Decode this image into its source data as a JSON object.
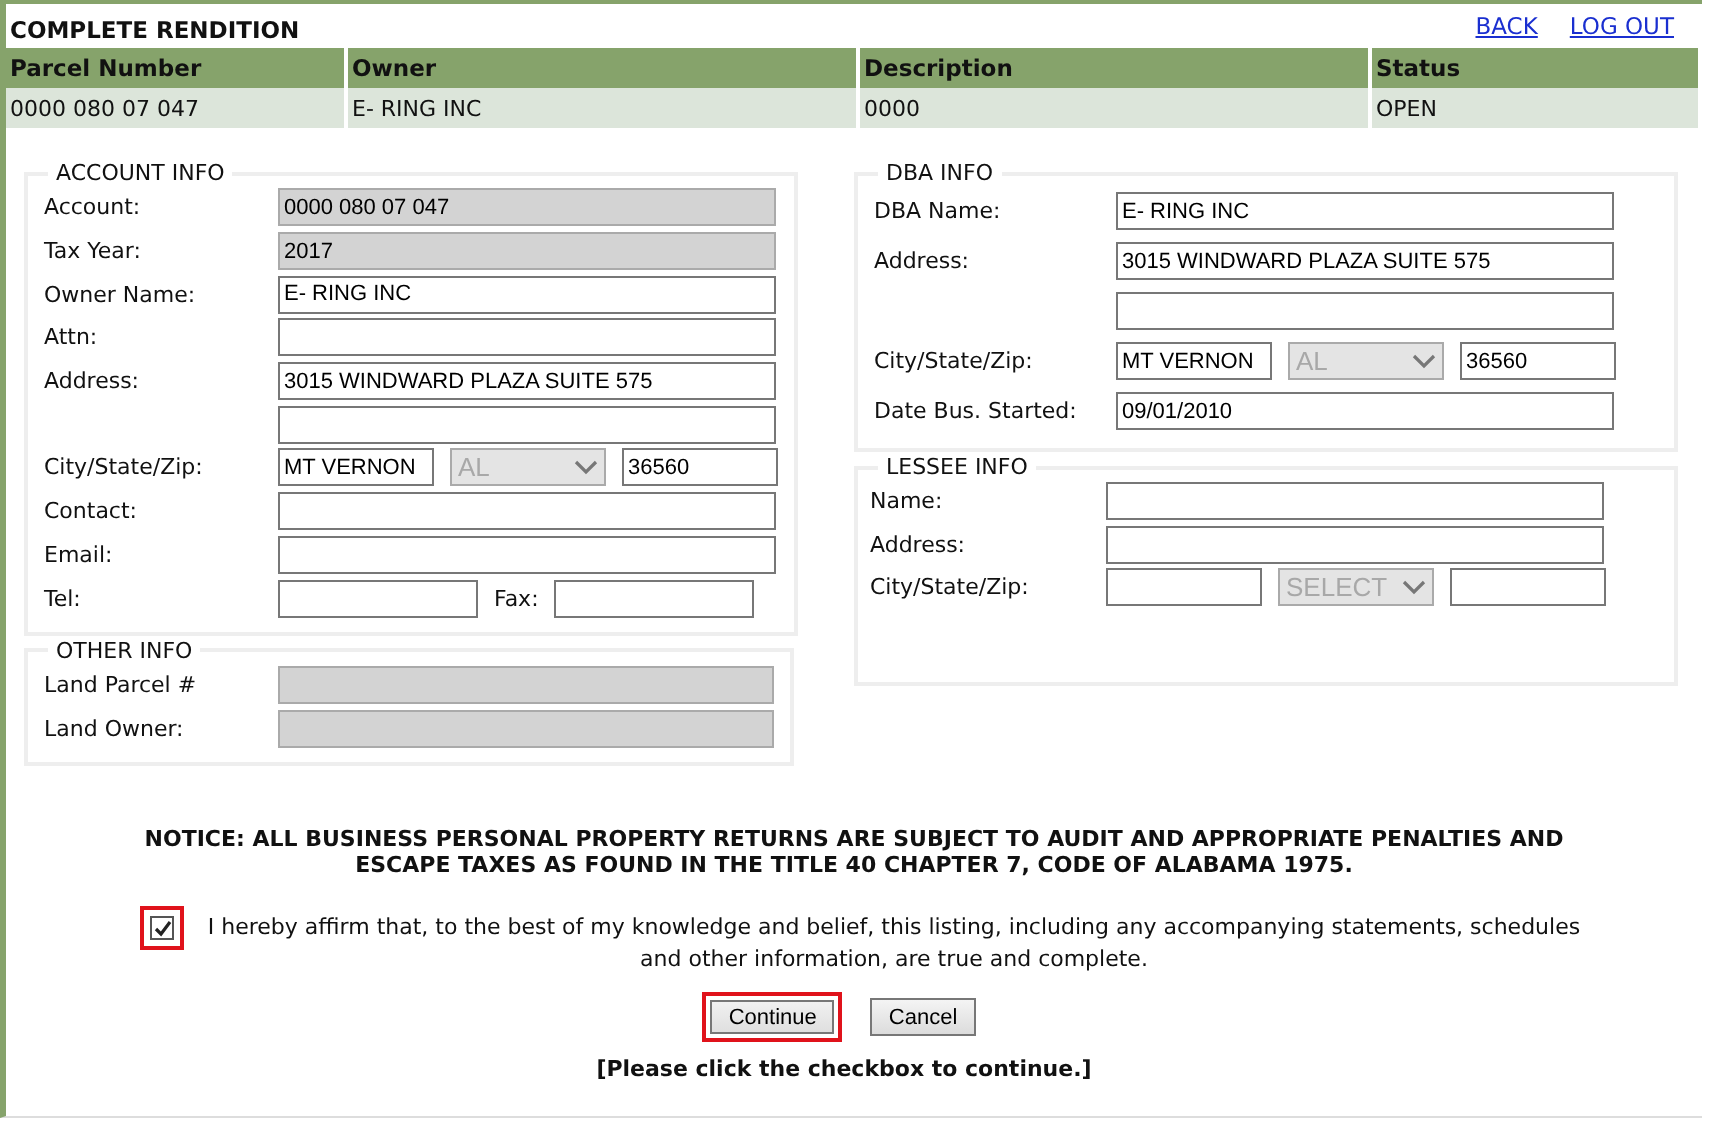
{
  "title": "COMPLETE RENDITION",
  "links": [
    "BACK",
    "LOG OUT"
  ],
  "table": {
    "columns": [
      "Parcel Number",
      "Owner",
      "Description",
      "Status"
    ],
    "rows": [
      [
        "0000 080 07 047",
        "E- RING INC",
        "0000",
        "OPEN"
      ]
    ]
  },
  "account_info": {
    "title": "ACCOUNT INFO",
    "rows": [
      {
        "label": "Account:",
        "fields": [
          {
            "kind": "full",
            "value": "0000 080 07 047",
            "disabled": true
          }
        ]
      },
      {
        "label": "Tax Year:",
        "fields": [
          {
            "kind": "full",
            "value": "2017",
            "disabled": true
          }
        ]
      },
      {
        "label": "Owner Name:",
        "fields": [
          {
            "kind": "full",
            "value": "E- RING INC",
            "disabled": false
          }
        ]
      },
      {
        "label": "Attn:",
        "fields": [
          {
            "kind": "full",
            "disabled": false
          }
        ]
      },
      {
        "label": "Address:",
        "fields": [
          {
            "kind": "full",
            "value": "3015 WINDWARD PLAZA SUITE 575",
            "disabled": false
          }
        ]
      },
      {
        "fields": [
          {
            "kind": "full",
            "disabled": false
          }
        ]
      },
      {
        "label": "City/State/Zip:",
        "fields": [
          {
            "kind": "city",
            "value": "MT VERNON",
            "disabled": false
          },
          {
            "kind": "select",
            "value": "AL",
            "disabled": true
          },
          {
            "kind": "zip",
            "value": "36560",
            "disabled": false
          }
        ]
      },
      {
        "label": "Contact:",
        "fields": [
          {
            "kind": "full",
            "disabled": false
          }
        ]
      },
      {
        "label": "Email:",
        "fields": [
          {
            "kind": "full",
            "disabled": false
          }
        ]
      },
      {
        "label": "Tel:",
        "fields": [
          {
            "kind": "half",
            "disabled": false
          },
          {
            "kind": "label",
            "text": "Fax:"
          },
          {
            "kind": "half",
            "disabled": false
          }
        ]
      }
    ]
  },
  "other_info": {
    "title": "OTHER INFO",
    "rows": [
      {
        "label": "Land Parcel #",
        "fields": [
          {
            "kind": "full",
            "disabled": true
          }
        ]
      },
      {
        "label": "Land Owner:",
        "fields": [
          {
            "kind": "full",
            "disabled": true
          }
        ]
      }
    ]
  },
  "dba_info": {
    "title": "DBA INFO",
    "rows": [
      {
        "label": "DBA Name:",
        "fields": [
          {
            "kind": "full",
            "value": "E- RING INC",
            "disabled": false
          }
        ]
      },
      {
        "label": "Address:",
        "fields": [
          {
            "kind": "full",
            "value": "3015 WINDWARD PLAZA SUITE 575",
            "disabled": false
          }
        ]
      },
      {
        "fields": [
          {
            "kind": "full",
            "disabled": false
          }
        ]
      },
      {
        "label": "City/State/Zip:",
        "fields": [
          {
            "kind": "city",
            "value": "MT VERNON",
            "disabled": false
          },
          {
            "kind": "select",
            "value": "AL",
            "disabled": true
          },
          {
            "kind": "zip",
            "value": "36560",
            "disabled": false
          }
        ]
      },
      {
        "label": "Date Bus. Started:",
        "fields": [
          {
            "kind": "full",
            "value": "09/01/2010",
            "disabled": false
          }
        ]
      }
    ]
  },
  "lessee_info": {
    "title": "LESSEE INFO",
    "rows": [
      {
        "label": "Name:",
        "fields": [
          {
            "kind": "full",
            "disabled": false
          }
        ]
      },
      {
        "label": "Address:",
        "fields": [
          {
            "kind": "full",
            "disabled": false
          }
        ]
      },
      {
        "label": "City/State/Zip:",
        "fields": [
          {
            "kind": "city",
            "disabled": false
          },
          {
            "kind": "select",
            "value": "SELECT",
            "disabled": true
          },
          {
            "kind": "zip",
            "disabled": false
          }
        ]
      }
    ]
  },
  "notice": "NOTICE: ALL BUSINESS PERSONAL PROPERTY RETURNS ARE SUBJECT TO AUDIT AND APPROPRIATE PENALTIES AND ESCAPE TAXES AS FOUND IN THE TITLE 40 CHAPTER 7, CODE OF ALABAMA 1975.",
  "affirm": {
    "checked": true,
    "text": "I hereby affirm that, to the best of my knowledge and belief, this listing, including any accompanying statements, schedules and other information, are true and complete."
  },
  "buttons": [
    {
      "label": "Continue",
      "highlighted": true
    },
    {
      "label": "Cancel",
      "highlighted": false
    }
  ],
  "hint": "[Please click the checkbox to continue.]"
}
